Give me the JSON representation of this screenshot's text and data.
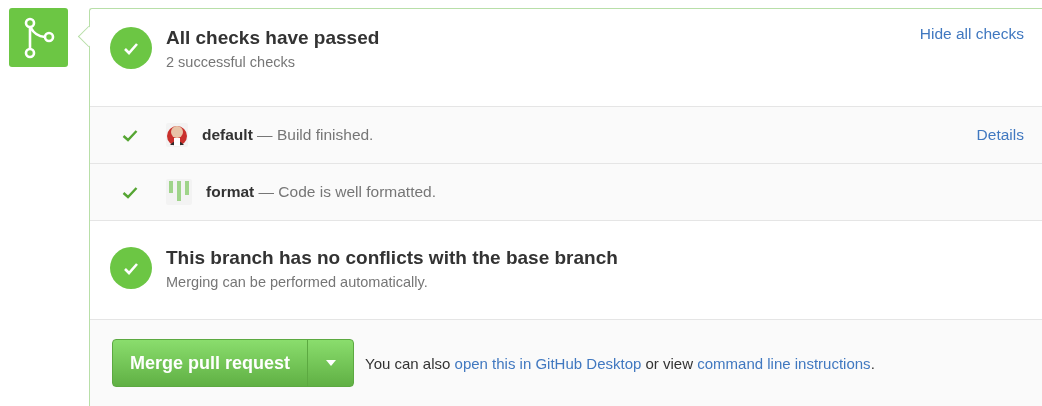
{
  "summary": {
    "title": "All checks have passed",
    "subtitle": "2 successful checks",
    "toggle_link": "Hide all checks"
  },
  "checks": [
    {
      "name": "default",
      "description": "— Build finished.",
      "kind": "avatar",
      "passed": true,
      "details_link": "Details"
    },
    {
      "name": "format",
      "description": "— Code is well formatted.",
      "kind": "bars",
      "passed": true
    }
  ],
  "conflicts": {
    "title": "This branch has no conflicts with the base branch",
    "subtitle": "Merging can be performed automatically."
  },
  "merge": {
    "button": "Merge pull request",
    "hint": [
      {
        "kind": "text",
        "text": "You can also "
      },
      {
        "kind": "link",
        "text": "open this in GitHub Desktop"
      },
      {
        "kind": "text",
        "text": " or view "
      },
      {
        "kind": "link",
        "text": "command line instructions"
      },
      {
        "kind": "text",
        "text": "."
      }
    ]
  }
}
